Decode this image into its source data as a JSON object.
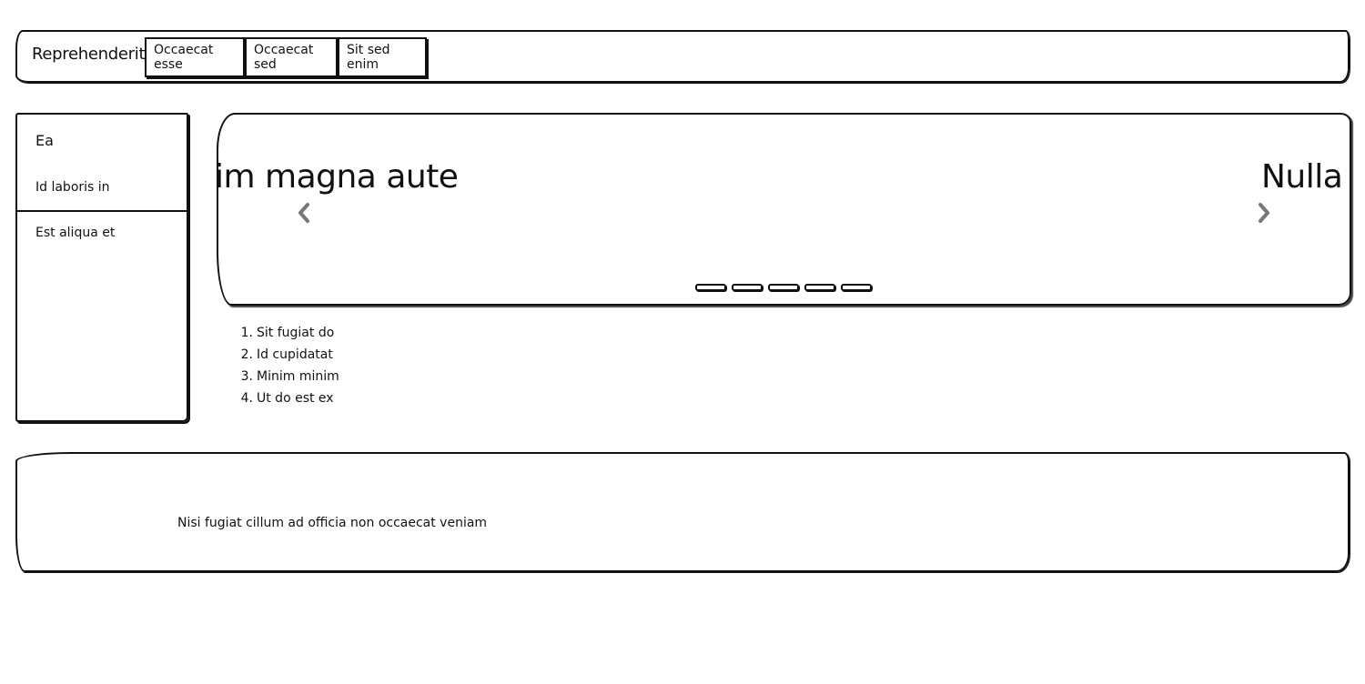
{
  "navbar": {
    "brand": "Reprehenderit",
    "buttons": [
      "Occaecat esse",
      "Occaecat sed",
      "Sit sed enim"
    ]
  },
  "sidebar": {
    "heading": "Ea",
    "items": [
      "Id laboris in",
      "Est aliqua et"
    ]
  },
  "carousel": {
    "slide_left_text": "im magna aute",
    "slide_right_text": "Nulla u",
    "prev_icon": "chevron-left-icon",
    "next_icon": "chevron-right-icon",
    "indicator_count": 5
  },
  "list": {
    "items": [
      {
        "num": "1.",
        "text": "Sit fugiat do"
      },
      {
        "num": "2.",
        "text": "Id cupidatat"
      },
      {
        "num": "3.",
        "text": "Minim minim"
      },
      {
        "num": "4.",
        "text": "Ut do est ex"
      }
    ]
  },
  "footer": {
    "text": "Nisi fugiat cillum ad officia non occaecat veniam"
  }
}
